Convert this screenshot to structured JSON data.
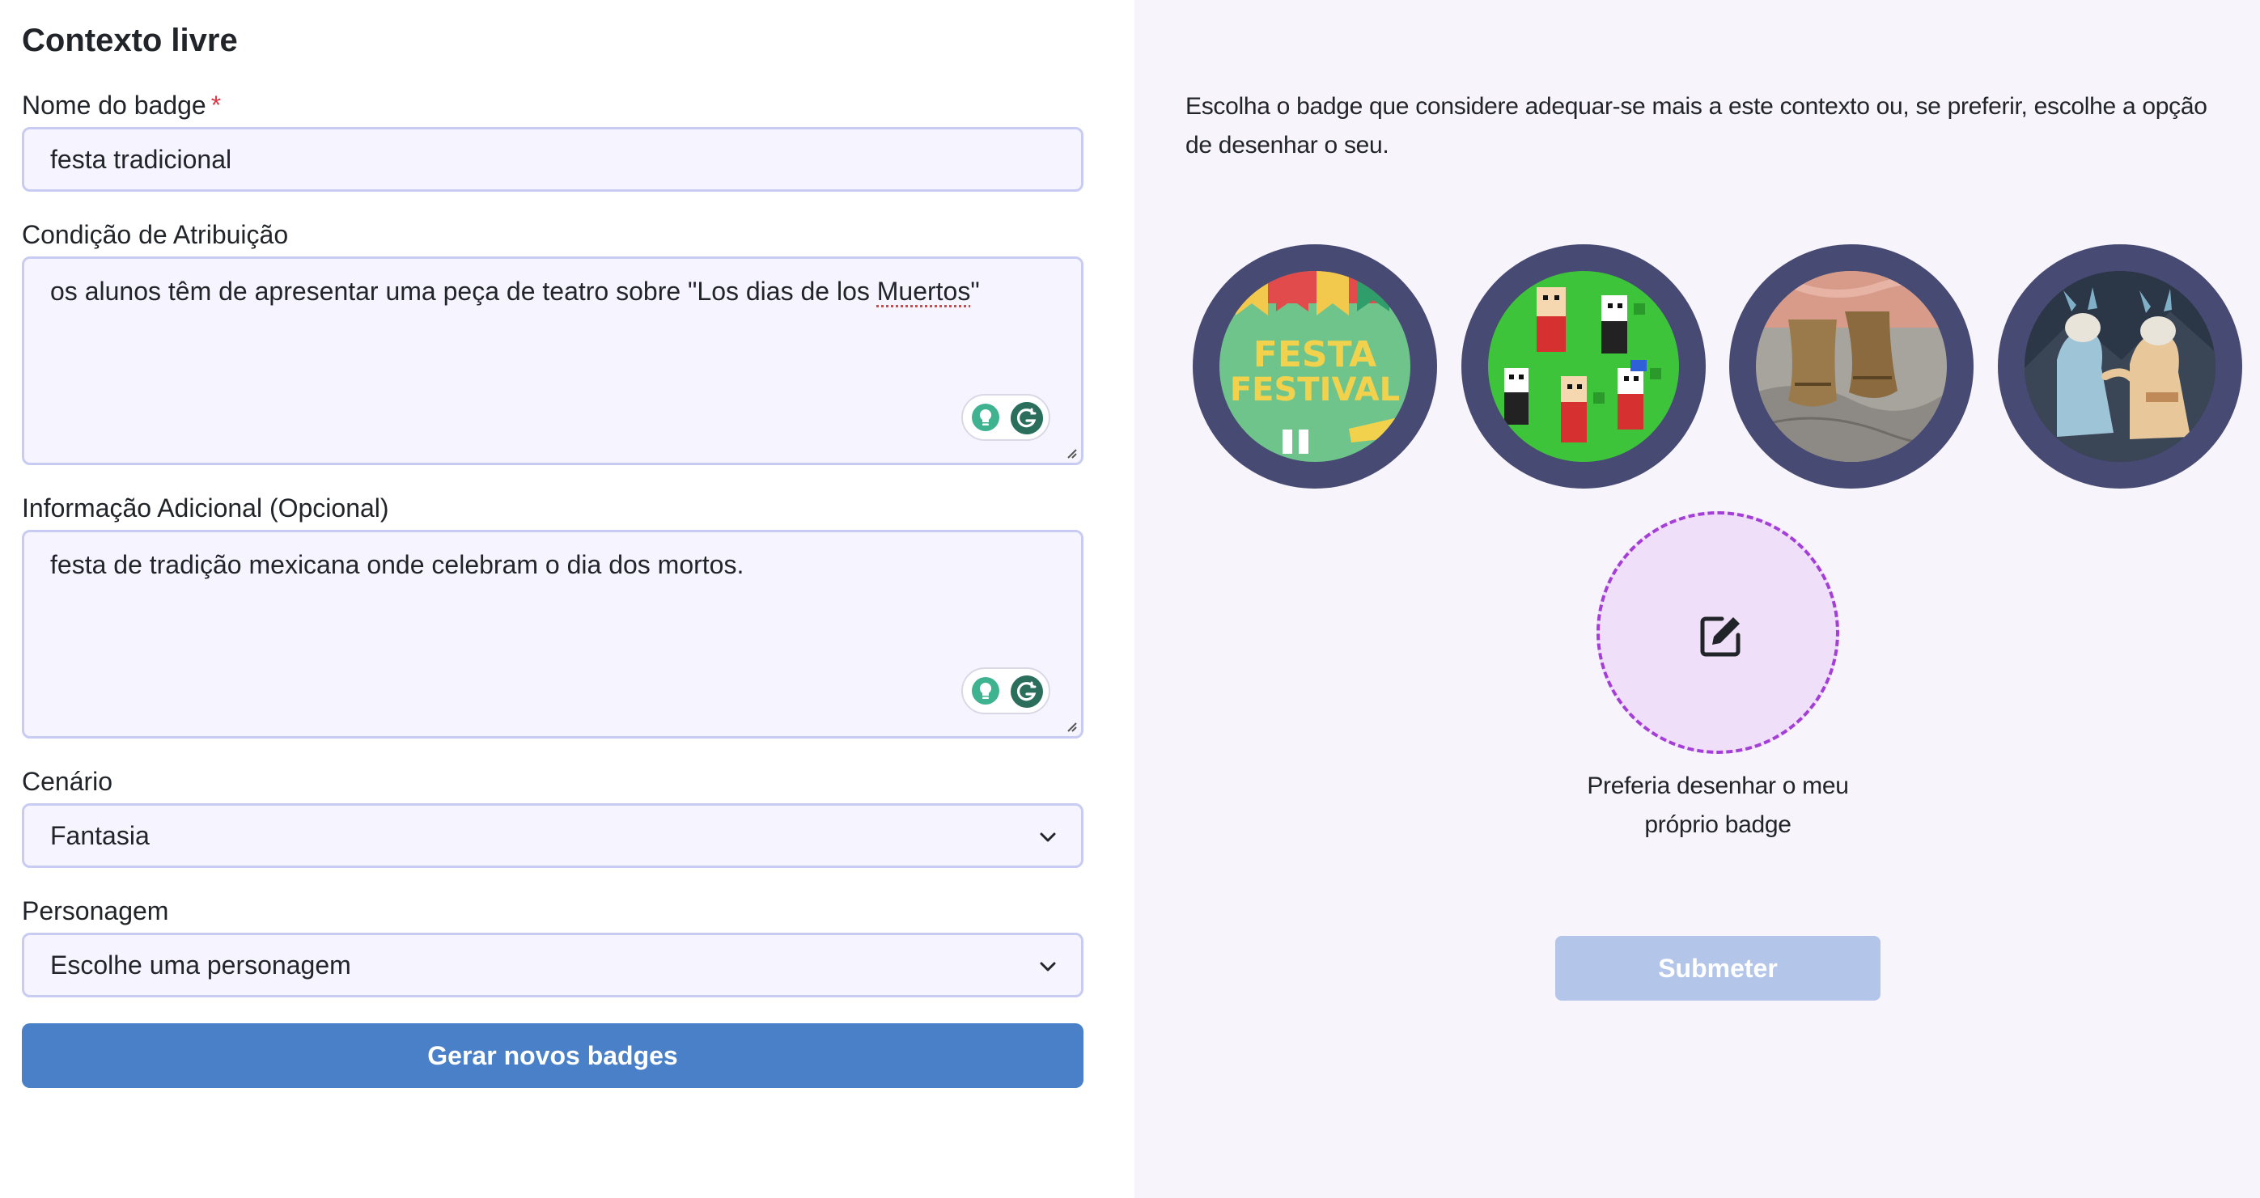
{
  "form": {
    "heading": "Contexto livre",
    "badge_name": {
      "label": "Nome do badge",
      "required_mark": "*",
      "value": "festa tradicional"
    },
    "condition": {
      "label": "Condição de Atribuição",
      "value_before": "os alunos têm de apresentar uma peça de teatro sobre \"Los dias de los ",
      "value_flagged": "Muertos",
      "value_after": "\""
    },
    "extra_info": {
      "label": "Informação Adicional (Opcional)",
      "value": "festa de tradição mexicana onde celebram o dia dos mortos."
    },
    "scenario": {
      "label": "Cenário",
      "selected": "Fantasia"
    },
    "character": {
      "label": "Personagem",
      "selected": "Escolhe uma personagem"
    },
    "generate_button": "Gerar novos badges"
  },
  "badges_panel": {
    "intro": "Escolha o badge que considere adequar-se mais a este contexto ou, se preferir, escolhe a opção de desenhar o seu.",
    "badges": [
      {
        "name": "festa-festival",
        "text": "FESTA",
        "text2": "FESTIVAL"
      },
      {
        "name": "pixel-characters"
      },
      {
        "name": "wooden-feet"
      },
      {
        "name": "illustrated-figures"
      }
    ],
    "draw_own_label": "Preferia desenhar o meu próprio badge",
    "submit_button": "Submeter"
  },
  "colors": {
    "primary_button": "#4a80c8",
    "disabled_button": "#b3c5e8",
    "badge_ring": "#474a72",
    "dashed_accent": "#a43ed8",
    "right_panel_bg": "#f8f4fc"
  }
}
